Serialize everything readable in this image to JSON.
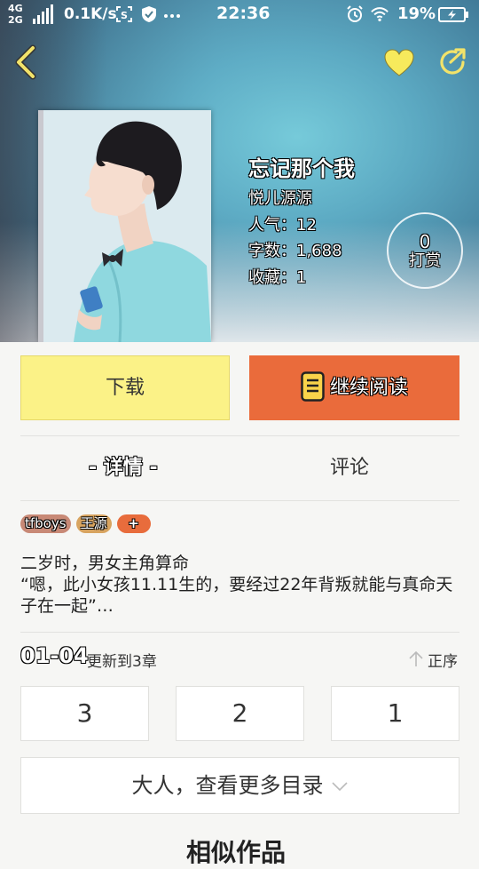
{
  "status_bar": {
    "network_top": "4G",
    "network_bottom": "2G",
    "speed": "0.1K/s",
    "time": "22:36",
    "battery": "19%"
  },
  "book": {
    "title": "忘记那个我",
    "author": "悦儿源源",
    "popularity": "人气：12",
    "word_count": "字数：1,688",
    "favorites": "收藏：1"
  },
  "tip": {
    "count": "0",
    "label": "打赏"
  },
  "actions": {
    "download": "下载",
    "continue_reading": "继续阅读"
  },
  "tabs": {
    "detail": "- 详情 -",
    "comment": "评论"
  },
  "tags": [
    "tfboys",
    "王源",
    "+"
  ],
  "synopsis": "二岁时，男女主角算命\n“嗯，此小女孩11.11生的，要经过22年背叛就能与真命天子在一起”…",
  "chapters": {
    "date": "01-04",
    "update_text": "更新到3章",
    "sort_label": "正序",
    "items": [
      "3",
      "2",
      "1"
    ],
    "more_label": "大人，查看更多目录"
  },
  "similar_heading": "相似作品",
  "colors": {
    "download_bg": "#fbf287",
    "read_bg": "#ea6b3b",
    "heart": "#f7ea5c",
    "back_arrow": "#f2e36a"
  }
}
